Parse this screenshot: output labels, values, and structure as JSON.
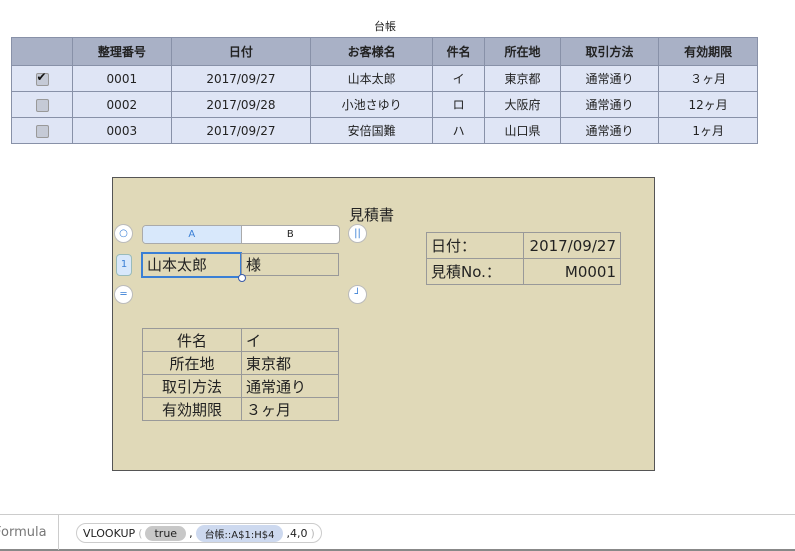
{
  "sheet": {
    "title": "台帳",
    "headers": [
      "",
      "整理番号",
      "日付",
      "お客様名",
      "件名",
      "所在地",
      "取引方法",
      "有効期限"
    ],
    "rows": [
      {
        "checked": true,
        "cells": [
          "0001",
          "2017/09/27",
          "山本太郎",
          "イ",
          "東京都",
          "通常通り",
          "３ヶ月"
        ]
      },
      {
        "checked": false,
        "cells": [
          "0002",
          "2017/09/28",
          "小池さゆり",
          "ロ",
          "大阪府",
          "通常通り",
          "12ヶ月"
        ]
      },
      {
        "checked": false,
        "cells": [
          "0003",
          "2017/09/27",
          "安倍国難",
          "ハ",
          "山口県",
          "通常通り",
          "1ヶ月"
        ]
      }
    ]
  },
  "estimate": {
    "title": "見積書",
    "col_a": "A",
    "col_b": "B",
    "row_num": "1",
    "name": "山本太郎",
    "honorific": "様",
    "date_label": "日付：",
    "date_value": "2017/09/27",
    "no_label": "見積No.：",
    "no_value": "M0001",
    "info": [
      [
        "件名",
        "イ"
      ],
      [
        "所在地",
        "東京都"
      ],
      [
        "取引方法",
        "通常通り"
      ],
      [
        "有効期限",
        "３ヶ月"
      ]
    ]
  },
  "formula": {
    "label": "Formula",
    "func": "VLOOKUP",
    "arg1": "true",
    "arg2": "台帳::A$1:H$4",
    "rest": ",4,0"
  }
}
